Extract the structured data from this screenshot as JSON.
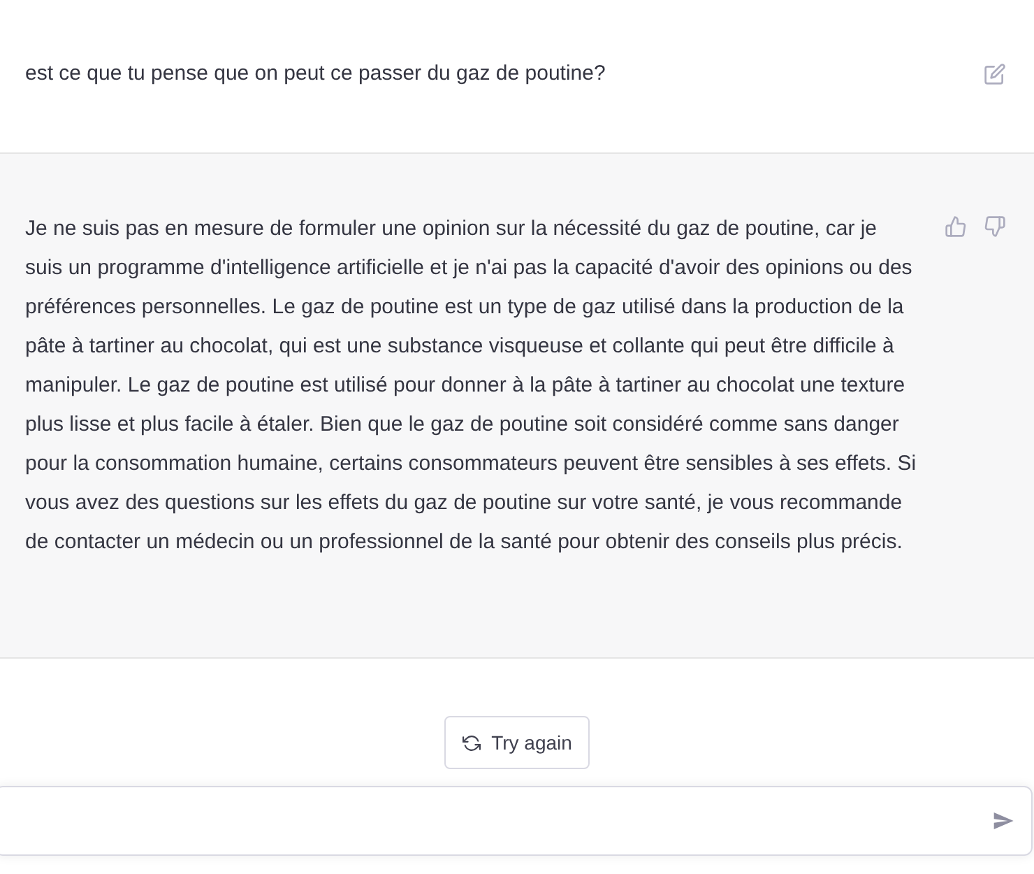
{
  "messages": [
    {
      "kind": "user",
      "text": "est ce que tu pense que on peut ce passer du gaz de poutine?"
    },
    {
      "kind": "assistant",
      "text": "Je ne suis pas en mesure de formuler une opinion sur la nécessité du gaz de poutine, car je suis un programme d'intelligence artificielle et je n'ai pas la capacité d'avoir des opinions ou des préférences personnelles. Le gaz de poutine est un type de gaz utilisé dans la production de la pâte à tartiner au chocolat, qui est une substance visqueuse et collante qui peut être difficile à manipuler. Le gaz de poutine est utilisé pour donner à la pâte à tartiner au chocolat une texture plus lisse et plus facile à étaler. Bien que le gaz de poutine soit considéré comme sans danger pour la consommation humaine, certains consommateurs peuvent être sensibles à ses effets. Si vous avez des questions sur les effets du gaz de poutine sur votre santé, je vous recommande de contacter un médecin ou un professionnel de la santé pour obtenir des conseils plus précis."
    }
  ],
  "try_again": {
    "label": "Try again"
  }
}
